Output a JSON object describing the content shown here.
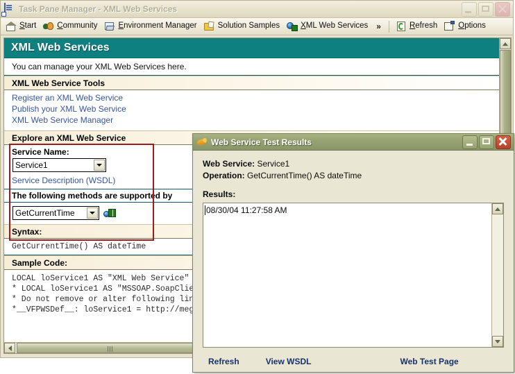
{
  "main_window": {
    "title": "Task Pane Manager - XML Web Services",
    "icon": "task-pane-document-icon",
    "window_buttons": {
      "minimize": "_",
      "maximize": "□",
      "close": "✕"
    },
    "toolbar": {
      "items": [
        {
          "label": "Start",
          "accel": "S",
          "icon": "home-icon"
        },
        {
          "label": "Community",
          "accel": "C",
          "icon": "people-icon"
        },
        {
          "label": "Environment Manager",
          "accel": "E",
          "icon": "environment-icon"
        },
        {
          "label": "Solution Samples",
          "accel": "S",
          "icon": "folder-icon"
        },
        {
          "label": "XML Web Services",
          "accel": "X",
          "icon": "globe-grid-icon"
        }
      ],
      "overflow": "»",
      "right_items": [
        {
          "label": "Refresh",
          "accel": "R",
          "icon": "refresh-icon"
        },
        {
          "label": "Options",
          "accel": "O",
          "icon": "options-icon"
        }
      ]
    },
    "pane": {
      "banner_title": "XML Web Services",
      "description": "You can manage your XML Web Services here.",
      "tools_section": {
        "header": "XML Web Service Tools",
        "links": [
          "Register an XML Web Service",
          "Publish your XML Web Service",
          "XML Web Service Manager"
        ]
      },
      "explore_section": {
        "header": "Explore an XML Web Service",
        "service_name_label": "Service Name:",
        "service_name_value": "Service1",
        "wsdl_link": "Service Description (WSDL)",
        "methods_header": "The following methods are supported by",
        "method_value": "GetCurrentTime",
        "run_icon": "run-web-service-icon"
      },
      "syntax_section": {
        "header": "Syntax:",
        "text": "GetCurrentTime() AS dateTime"
      },
      "sample_section": {
        "header": "Sample Code:",
        "lines": [
          "LOCAL loService1 AS \"XML Web Service\"",
          "* LOCAL loService1 AS \"MSSOAP.SoapClie",
          "* Do not remove or alter following lin",
          "*__VFPWSDef__: loService1 = http://meg"
        ]
      }
    }
  },
  "dialog": {
    "title": "Web Service Test Results",
    "icon": "fox-icon",
    "window_buttons": {
      "minimize": "_",
      "maximize": "□",
      "close": "✕"
    },
    "web_service_label": "Web Service:",
    "web_service_value": "Service1",
    "operation_label": "Operation:",
    "operation_value": "GetCurrentTime() AS dateTime",
    "results_label": "Results:",
    "results_value": "08/30/04 11:27:58 AM",
    "footer_links": [
      "Refresh",
      "View WSDL",
      "Web Test Page"
    ]
  },
  "colors": {
    "banner_teal": "#0f8080",
    "highlight_red": "#9e1b1b",
    "link_blue": "#36559b",
    "dialog_title_green": "#98a374",
    "footer_link_blue": "#16316b"
  }
}
